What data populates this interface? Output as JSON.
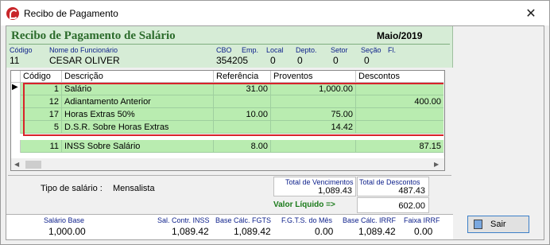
{
  "window": {
    "title": "Recibo de Pagamento",
    "close_glyph": "✕"
  },
  "header": {
    "title": "Recibo de Pagamento de Salário",
    "period": "Maio/2019",
    "labels": {
      "codigo": "Código",
      "nome": "Nome do Funcionário",
      "cbo": "CBO",
      "emp": "Emp.",
      "local": "Local",
      "depto": "Depto.",
      "setor": "Setor",
      "secao": "Seção",
      "fl": "Fl."
    },
    "values": {
      "codigo": "11",
      "nome": "CESAR OLIVER",
      "cbo": "354205",
      "emp": "0",
      "local": "0",
      "depto": "0",
      "setor": "0",
      "secao": "0",
      "fl": ""
    }
  },
  "grid": {
    "columns": [
      "Código",
      "Descrição",
      "Referência",
      "Proventos",
      "Descontos"
    ],
    "rows": [
      {
        "codigo": "1",
        "descricao": "Salário",
        "referencia": "31.00",
        "proventos": "1,000.00",
        "descontos": ""
      },
      {
        "codigo": "12",
        "descricao": "Adiantamento Anterior",
        "referencia": "",
        "proventos": "",
        "descontos": "400.00"
      },
      {
        "codigo": "17",
        "descricao": "Horas Extras 50%",
        "referencia": "10.00",
        "proventos": "75.00",
        "descontos": ""
      },
      {
        "codigo": "5",
        "descricao": "D.S.R. Sobre Horas Extras",
        "referencia": "",
        "proventos": "14.42",
        "descontos": ""
      },
      {
        "codigo": "11",
        "descricao": "INSS Sobre Salário",
        "referencia": "8.00",
        "proventos": "",
        "descontos": "87.15"
      }
    ]
  },
  "summary": {
    "tipo_label": "Tipo de salário :",
    "tipo_value": "Mensalista",
    "total_venc_label": "Total de Vencimentos",
    "total_venc": "1,089.43",
    "total_desc_label": "Total de Descontos",
    "total_desc": "487.43",
    "liquido_label": "Valor Líquido  =>",
    "liquido": "602.00"
  },
  "bottom": {
    "salario_base_label": "Salário Base",
    "salario_base": "1,000.00",
    "sal_inss_label": "Sal. Contr. INSS",
    "sal_inss": "1,089.42",
    "base_fgts_label": "Base Cálc. FGTS",
    "base_fgts": "1,089.42",
    "fgts_mes_label": "F.G.T.S. do Mês",
    "fgts_mes": "0.00",
    "base_irrf_label": "Base Cálc. IRRF",
    "base_irrf": "1,089.42",
    "faixa_irrf_label": "Faixa IRRF",
    "faixa_irrf": "0.00"
  },
  "buttons": {
    "sair": "Sair"
  },
  "colors": {
    "header_bg": "#d6ecd6",
    "row_bg": "#b9ecb0",
    "title_green": "#2b6b2b",
    "label_blue": "#0b1e8a",
    "highlight_red": "#d8232a"
  }
}
